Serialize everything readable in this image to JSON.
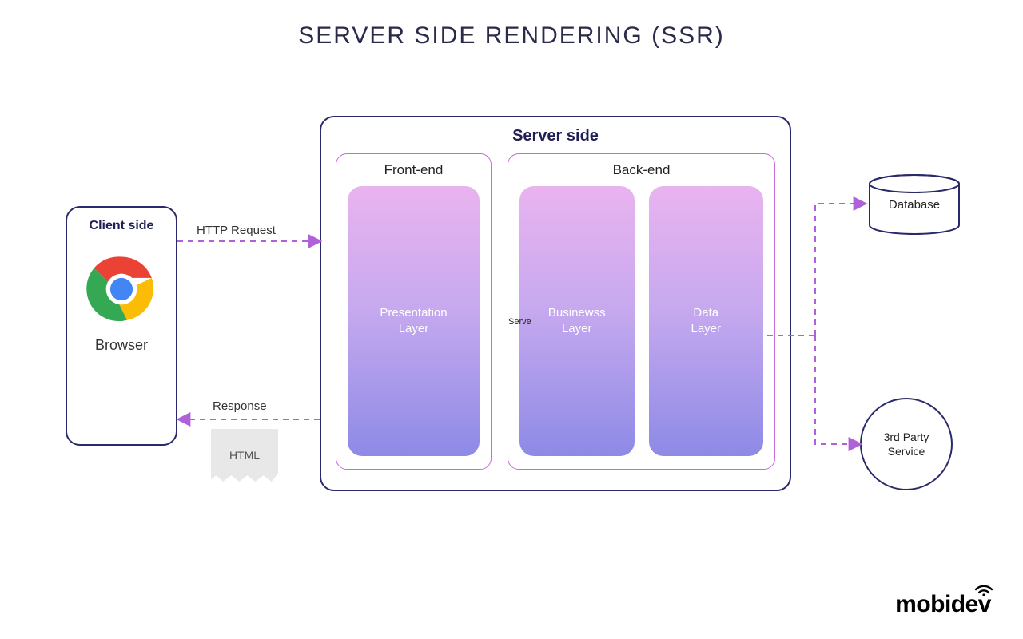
{
  "title": "SERVER SIDE RENDERING (SSR)",
  "client": {
    "box_title": "Client side",
    "browser_label": "Browser"
  },
  "arrows": {
    "request_label": "HTTP Request",
    "response_label": "Response",
    "response_doc": "HTML"
  },
  "server": {
    "box_title": "Server side",
    "artifact_text": "Serve",
    "frontend": {
      "title": "Front-end",
      "layers": [
        "Presentation\nLayer"
      ]
    },
    "backend": {
      "title": "Back-end",
      "layers": [
        "Businewss\nLayer",
        "Data\nLayer"
      ]
    }
  },
  "external": {
    "database_label": "Database",
    "third_party_label": "3rd Party\nService"
  },
  "brand": "mobidev",
  "colors": {
    "box_border": "#2a2a6a",
    "section_border": "#c86adf",
    "arrow": "#b060d8"
  }
}
